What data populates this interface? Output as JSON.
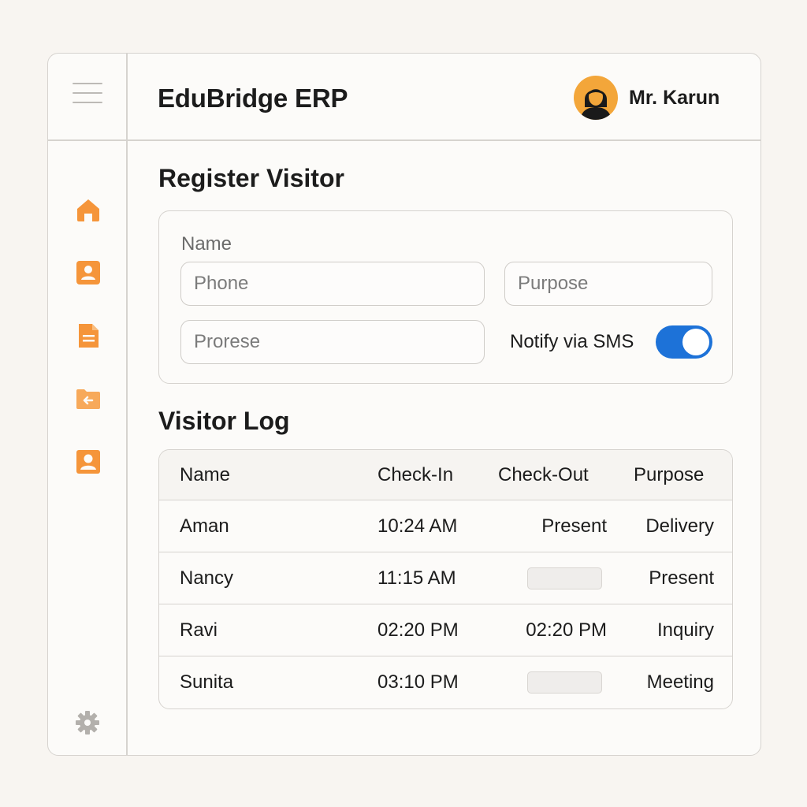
{
  "header": {
    "app_title": "EduBridge ERP",
    "user_name": "Mr. Karun",
    "menu_icon": "hamburger-menu-icon",
    "avatar_icon": "user-avatar-icon"
  },
  "sidebar": {
    "items": [
      {
        "icon": "home-icon"
      },
      {
        "icon": "contact-card-icon"
      },
      {
        "icon": "document-icon"
      },
      {
        "icon": "folder-arrow-icon"
      },
      {
        "icon": "profile-icon"
      }
    ],
    "footer_icon": "gear-icon"
  },
  "register": {
    "title": "Register Visitor",
    "name_label": "Name",
    "phone_placeholder": "Phone",
    "purpose_placeholder": "Purpose",
    "prorese_placeholder": "Prorese",
    "notify_label": "Notify via SMS",
    "notify_on": true
  },
  "log": {
    "title": "Visitor Log",
    "columns": {
      "name": "Name",
      "check_in": "Check-In",
      "check_out": "Check-Out",
      "purpose": "Purpose"
    },
    "rows": [
      {
        "name": "Aman",
        "check_in": "10:24 AM",
        "check_out": "Present",
        "purpose": "Delivery"
      },
      {
        "name": "Nancy",
        "check_in": "11:15 AM",
        "check_out": "",
        "purpose": "Present"
      },
      {
        "name": "Ravi",
        "check_in": "02:20 PM",
        "check_out": "02:20 PM",
        "purpose": "Inquiry"
      },
      {
        "name": "Sunita",
        "check_in": "03:10 PM",
        "check_out": "",
        "purpose": "Meeting"
      }
    ]
  },
  "colors": {
    "accent_orange": "#f5953a",
    "toggle_blue": "#1d72d8",
    "border": "#d6d3cf"
  }
}
